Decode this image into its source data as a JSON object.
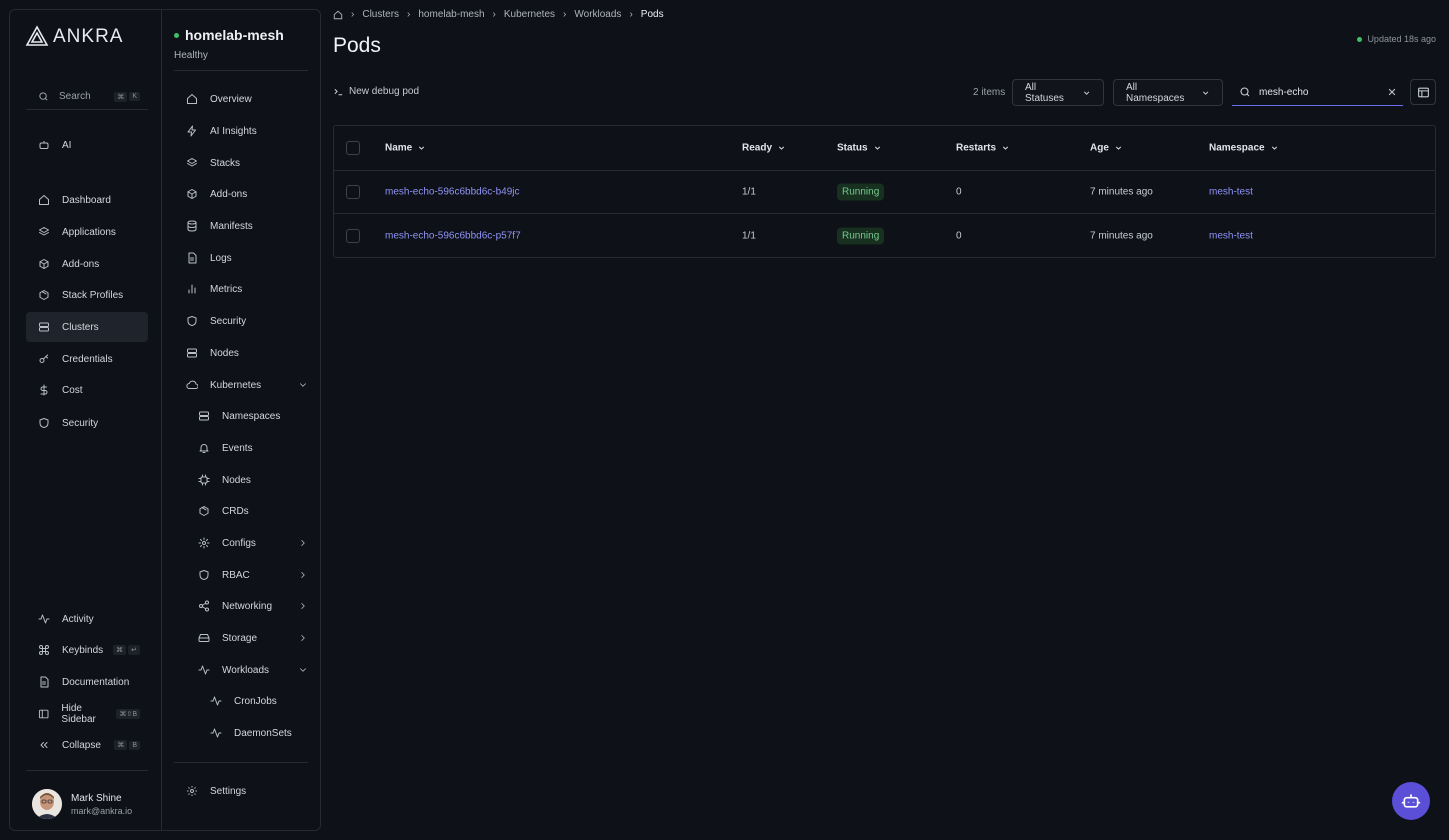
{
  "brand": {
    "name": "ANKRA"
  },
  "search": {
    "label": "Search",
    "kbd": [
      "⌘",
      "K"
    ]
  },
  "primary_nav": {
    "ai": "AI",
    "items": [
      {
        "label": "Dashboard",
        "icon": "home-icon"
      },
      {
        "label": "Applications",
        "icon": "layers-icon"
      },
      {
        "label": "Add-ons",
        "icon": "package-icon"
      },
      {
        "label": "Stack Profiles",
        "icon": "box-icon"
      },
      {
        "label": "Clusters",
        "icon": "server-icon"
      },
      {
        "label": "Credentials",
        "icon": "key-icon"
      },
      {
        "label": "Cost",
        "icon": "dollar-icon"
      },
      {
        "label": "Security",
        "icon": "shield-icon"
      }
    ],
    "footer": [
      {
        "label": "Activity",
        "icon": "activity-icon",
        "kbd": []
      },
      {
        "label": "Keybinds",
        "icon": "command-icon",
        "kbd": [
          "⌘",
          "↵"
        ]
      },
      {
        "label": "Documentation",
        "icon": "document-icon",
        "kbd": []
      },
      {
        "label": "Hide Sidebar",
        "icon": "sidebar-icon",
        "kbd": [
          "⌘⇧B"
        ]
      },
      {
        "label": "Collapse",
        "icon": "chevrons-left-icon",
        "kbd": [
          "⌘",
          "B"
        ]
      }
    ]
  },
  "user": {
    "name": "Mark Shine",
    "email": "mark@ankra.io"
  },
  "cluster": {
    "name": "homelab-mesh",
    "status": "Healthy",
    "nav": [
      {
        "label": "Overview"
      },
      {
        "label": "AI Insights"
      },
      {
        "label": "Stacks"
      },
      {
        "label": "Add-ons"
      },
      {
        "label": "Manifests"
      },
      {
        "label": "Logs"
      },
      {
        "label": "Metrics"
      },
      {
        "label": "Security"
      },
      {
        "label": "Nodes"
      },
      {
        "label": "Kubernetes"
      }
    ],
    "kube": [
      {
        "label": "Namespaces"
      },
      {
        "label": "Events"
      },
      {
        "label": "Nodes"
      },
      {
        "label": "CRDs"
      },
      {
        "label": "Configs"
      },
      {
        "label": "RBAC"
      },
      {
        "label": "Networking"
      },
      {
        "label": "Storage"
      },
      {
        "label": "Workloads"
      }
    ],
    "workloads": [
      {
        "label": "CronJobs"
      },
      {
        "label": "DaemonSets"
      }
    ],
    "settings": "Settings"
  },
  "breadcrumbs": [
    "Clusters",
    "homelab-mesh",
    "Kubernetes",
    "Workloads",
    "Pods"
  ],
  "page": {
    "title": "Pods",
    "updated": "Updated 18s ago"
  },
  "toolbar": {
    "debug": "New debug pod",
    "count": "2 items",
    "status_filter": "All Statuses",
    "namespace_filter": "All Namespaces",
    "search_value": "mesh-echo"
  },
  "table": {
    "columns": [
      "Name",
      "Ready",
      "Status",
      "Restarts",
      "Age",
      "Namespace"
    ],
    "rows": [
      {
        "name": "mesh-echo-596c6bbd6c-b49jc",
        "ready": "1/1",
        "status": "Running",
        "restarts": "0",
        "age": "7 minutes ago",
        "namespace": "mesh-test"
      },
      {
        "name": "mesh-echo-596c6bbd6c-p57f7",
        "ready": "1/1",
        "status": "Running",
        "restarts": "0",
        "age": "7 minutes ago",
        "namespace": "mesh-test"
      }
    ]
  },
  "colors": {
    "accent": "#5a4fd6",
    "link": "#8f93f5",
    "healthy": "#3fbf6a",
    "running_bg": "#17301f",
    "running_text": "#79c98e"
  }
}
